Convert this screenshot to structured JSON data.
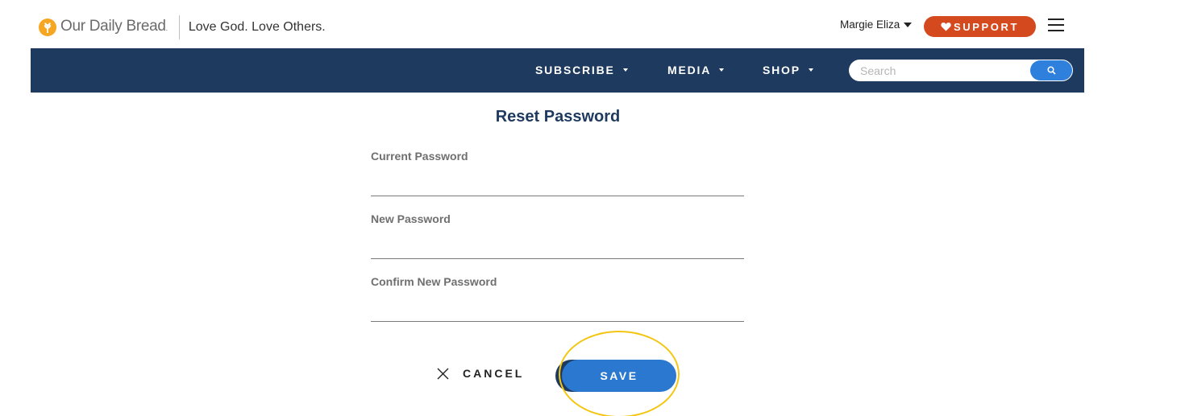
{
  "header": {
    "brand": "Our Daily Bread",
    "brand_reg": ".",
    "tagline": "Love God. Love Others.",
    "user_name": "Margie Eliza",
    "support_label": "SUPPORT"
  },
  "nav": {
    "items": [
      {
        "label": "SUBSCRIBE"
      },
      {
        "label": "MEDIA"
      },
      {
        "label": "SHOP"
      }
    ],
    "search_placeholder": "Search"
  },
  "form": {
    "title": "Reset Password",
    "fields": [
      {
        "label": "Current Password",
        "value": ""
      },
      {
        "label": "New Password",
        "value": ""
      },
      {
        "label": "Confirm New Password",
        "value": ""
      }
    ],
    "cancel_label": "CANCEL",
    "save_label": "SAVE"
  },
  "colors": {
    "navy": "#1f3a5f",
    "support_orange": "#d5491f",
    "primary_blue": "#2b78d0",
    "logo_orange": "#f5a623",
    "highlight_yellow": "#f3c613"
  },
  "icons": {
    "logo": "wheat-sun-icon",
    "support": "heart-icon",
    "menu": "hamburger-icon",
    "search": "search-icon",
    "cancel": "close-icon"
  }
}
